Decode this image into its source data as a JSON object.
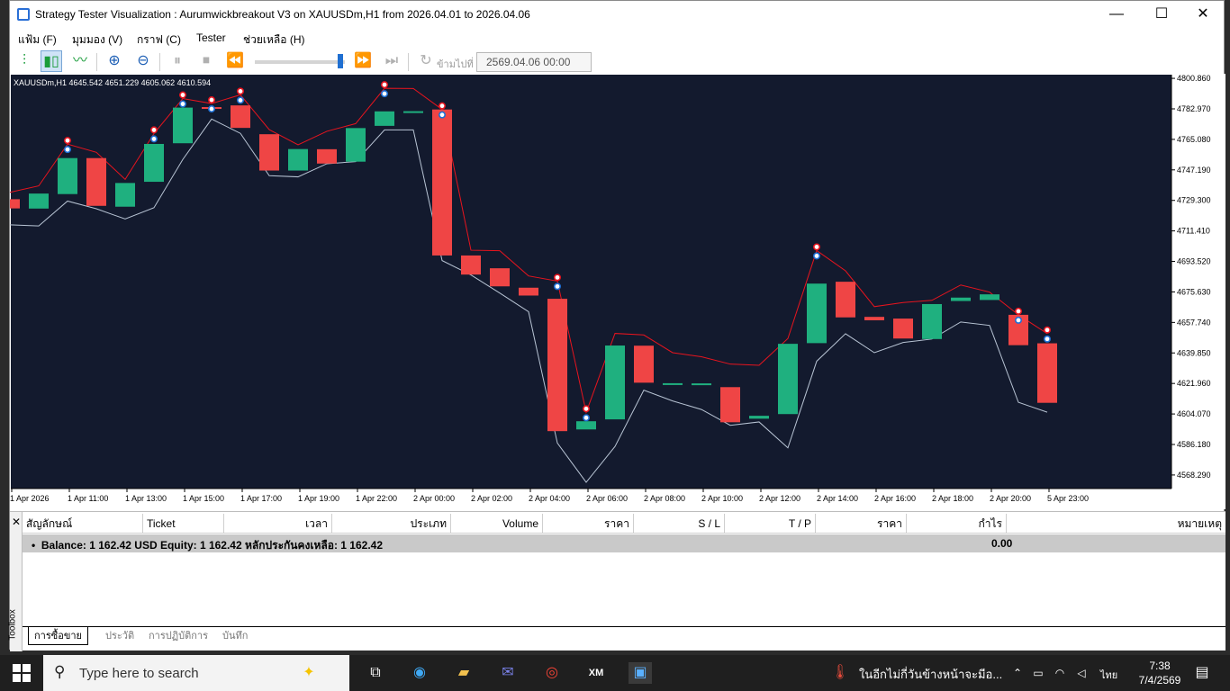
{
  "window": {
    "title": "Strategy Tester Visualization : Aurumwickbreakout V3 on XAUUSDm,H1 from 2026.04.01 to 2026.04.06",
    "minimize": "—",
    "maximize": "☐",
    "close": "✕"
  },
  "menu": [
    "แฟ้ม (F)",
    "มุมมอง (V)",
    "กราฟ (C)",
    "Tester",
    "ช่วยเหลือ (H)"
  ],
  "toolbar": {
    "skip_label": "ข้ามไปที่",
    "date_value": "2569.04.06 00:00"
  },
  "chart_data": {
    "type": "candlestick",
    "symbol_label": "XAUUSDm,H1  4645.542 4651.229 4605.062 4610.594",
    "background": "#131a2e",
    "bull_color": "#1fb07f",
    "bear_color": "#ef4545",
    "upper_line_color": "#e8141e",
    "lower_line_color": "#b8c4d4",
    "y_ticks": [
      "4800.860",
      "4782.970",
      "4765.080",
      "4747.190",
      "4729.300",
      "4711.410",
      "4693.520",
      "4675.630",
      "4657.740",
      "4639.850",
      "4621.960",
      "4604.070",
      "4586.180",
      "4568.290"
    ],
    "ylim": [
      4560.33,
      4803.01
    ],
    "x_ticks": [
      "1 Apr 2026",
      "1 Apr 11:00",
      "1 Apr 13:00",
      "1 Apr 15:00",
      "1 Apr 17:00",
      "1 Apr 19:00",
      "1 Apr 22:00",
      "2 Apr 00:00",
      "2 Apr 02:00",
      "2 Apr 04:00",
      "2 Apr 06:00",
      "2 Apr 08:00",
      "2 Apr 10:00",
      "2 Apr 12:00",
      "2 Apr 14:00",
      "2 Apr 16:00",
      "2 Apr 18:00",
      "2 Apr 20:00",
      "5 Apr 23:00"
    ],
    "candles": [
      {
        "o": 4730.0,
        "h": 4734.0,
        "l": 4715.0,
        "c": 4724.6
      },
      {
        "o": 4724.5,
        "h": 4737.8,
        "l": 4714.3,
        "c": 4733.3
      },
      {
        "o": 4733.0,
        "h": 4762.3,
        "l": 4728.9,
        "c": 4754.1
      },
      {
        "o": 4754.1,
        "h": 4757.5,
        "l": 4724.4,
        "c": 4726.1
      },
      {
        "o": 4725.6,
        "h": 4741.6,
        "l": 4718.4,
        "c": 4739.5
      },
      {
        "o": 4740.2,
        "h": 4768.5,
        "l": 4725.0,
        "c": 4762.4
      },
      {
        "o": 4762.8,
        "h": 4789.0,
        "l": 4753.3,
        "c": 4783.7
      },
      {
        "o": 4784.0,
        "h": 4786.1,
        "l": 4777.0,
        "c": 4783.6
      },
      {
        "o": 4785.0,
        "h": 4791.2,
        "l": 4768.6,
        "c": 4771.8
      },
      {
        "o": 4768.1,
        "h": 4770.8,
        "l": 4743.8,
        "c": 4746.8
      },
      {
        "o": 4746.8,
        "h": 4761.9,
        "l": 4743.1,
        "c": 4759.4
      },
      {
        "o": 4759.3,
        "h": 4769.8,
        "l": 4750.8,
        "c": 4750.9
      },
      {
        "o": 4752.0,
        "h": 4774.3,
        "l": 4752.0,
        "c": 4771.7
      },
      {
        "o": 4773.0,
        "h": 4795.0,
        "l": 4770.6,
        "c": 4781.5
      },
      {
        "o": 4781.5,
        "h": 4794.9,
        "l": 4770.6,
        "c": 4781.6
      },
      {
        "o": 4782.6,
        "h": 4782.6,
        "l": 4694.0,
        "c": 4697.0
      },
      {
        "o": 4697.0,
        "h": 4700.1,
        "l": 4685.6,
        "c": 4685.8
      },
      {
        "o": 4689.5,
        "h": 4699.8,
        "l": 4675.0,
        "c": 4678.9
      },
      {
        "o": 4678.1,
        "h": 4685.0,
        "l": 4664.0,
        "c": 4673.5
      },
      {
        "o": 4671.6,
        "h": 4682.0,
        "l": 4587.0,
        "c": 4594.0
      },
      {
        "o": 4595.0,
        "h": 4605.0,
        "l": 4564.0,
        "c": 4599.8
      },
      {
        "o": 4600.9,
        "h": 4651.3,
        "l": 4585.0,
        "c": 4644.2
      },
      {
        "o": 4644.1,
        "h": 4650.4,
        "l": 4618.0,
        "c": 4622.4
      },
      {
        "o": 4622.0,
        "h": 4640.0,
        "l": 4611.7,
        "c": 4622.1
      },
      {
        "o": 4622.0,
        "h": 4637.6,
        "l": 4606.7,
        "c": 4622.0
      },
      {
        "o": 4619.8,
        "h": 4633.3,
        "l": 4597.4,
        "c": 4599.2
      },
      {
        "o": 4601.3,
        "h": 4632.6,
        "l": 4599.4,
        "c": 4603.0
      },
      {
        "o": 4604.0,
        "h": 4648.3,
        "l": 4584.2,
        "c": 4645.2
      },
      {
        "o": 4645.6,
        "h": 4699.9,
        "l": 4635.0,
        "c": 4680.5
      },
      {
        "o": 4681.6,
        "h": 4688.0,
        "l": 4651.1,
        "c": 4660.7
      },
      {
        "o": 4661.0,
        "h": 4667.0,
        "l": 4640.0,
        "c": 4659.0
      },
      {
        "o": 4660.0,
        "h": 4669.4,
        "l": 4646.0,
        "c": 4648.3
      },
      {
        "o": 4648.0,
        "h": 4670.7,
        "l": 4648.0,
        "c": 4668.5
      },
      {
        "o": 4670.3,
        "h": 4679.7,
        "l": 4658.0,
        "c": 4672.3
      },
      {
        "o": 4670.9,
        "h": 4675.5,
        "l": 4656.0,
        "c": 4674.2
      },
      {
        "o": 4662.2,
        "h": 4662.2,
        "l": 4610.9,
        "c": 4644.4
      },
      {
        "o": 4645.5,
        "h": 4651.2,
        "l": 4605.1,
        "c": 4610.6
      }
    ],
    "signals_sell_idx": [
      2,
      5,
      6,
      7,
      8,
      13,
      15,
      19,
      20,
      28,
      35,
      36
    ],
    "signals_buy_idx": [
      2,
      5,
      6,
      7,
      8,
      13,
      15,
      19,
      20,
      28,
      35,
      36
    ]
  },
  "toolbox": {
    "side_label": "Toolbox",
    "columns": [
      "สัญลักษณ์",
      "Ticket",
      "เวลา",
      "ประเภท",
      "Volume",
      "ราคา",
      "S / L",
      "T / P",
      "ราคา",
      "กำไร",
      "หมายเหตุ"
    ],
    "balance_text": "Balance: 1 162.42 USD  Equity: 1 162.42  หลักประกันคงเหลือ: 1 162.42",
    "balance_profit": "0.00",
    "tabs": [
      "การซื้อขาย",
      "ประวัติ",
      "การปฏิบัติการ",
      "บันทึก"
    ]
  },
  "taskbar": {
    "search_placeholder": "Type here to search",
    "notification": "ในอีกไม่กี่วันข้างหน้าจะมีอ...",
    "lang": "ไทย",
    "time": "7:38",
    "date": "7/4/2569"
  }
}
